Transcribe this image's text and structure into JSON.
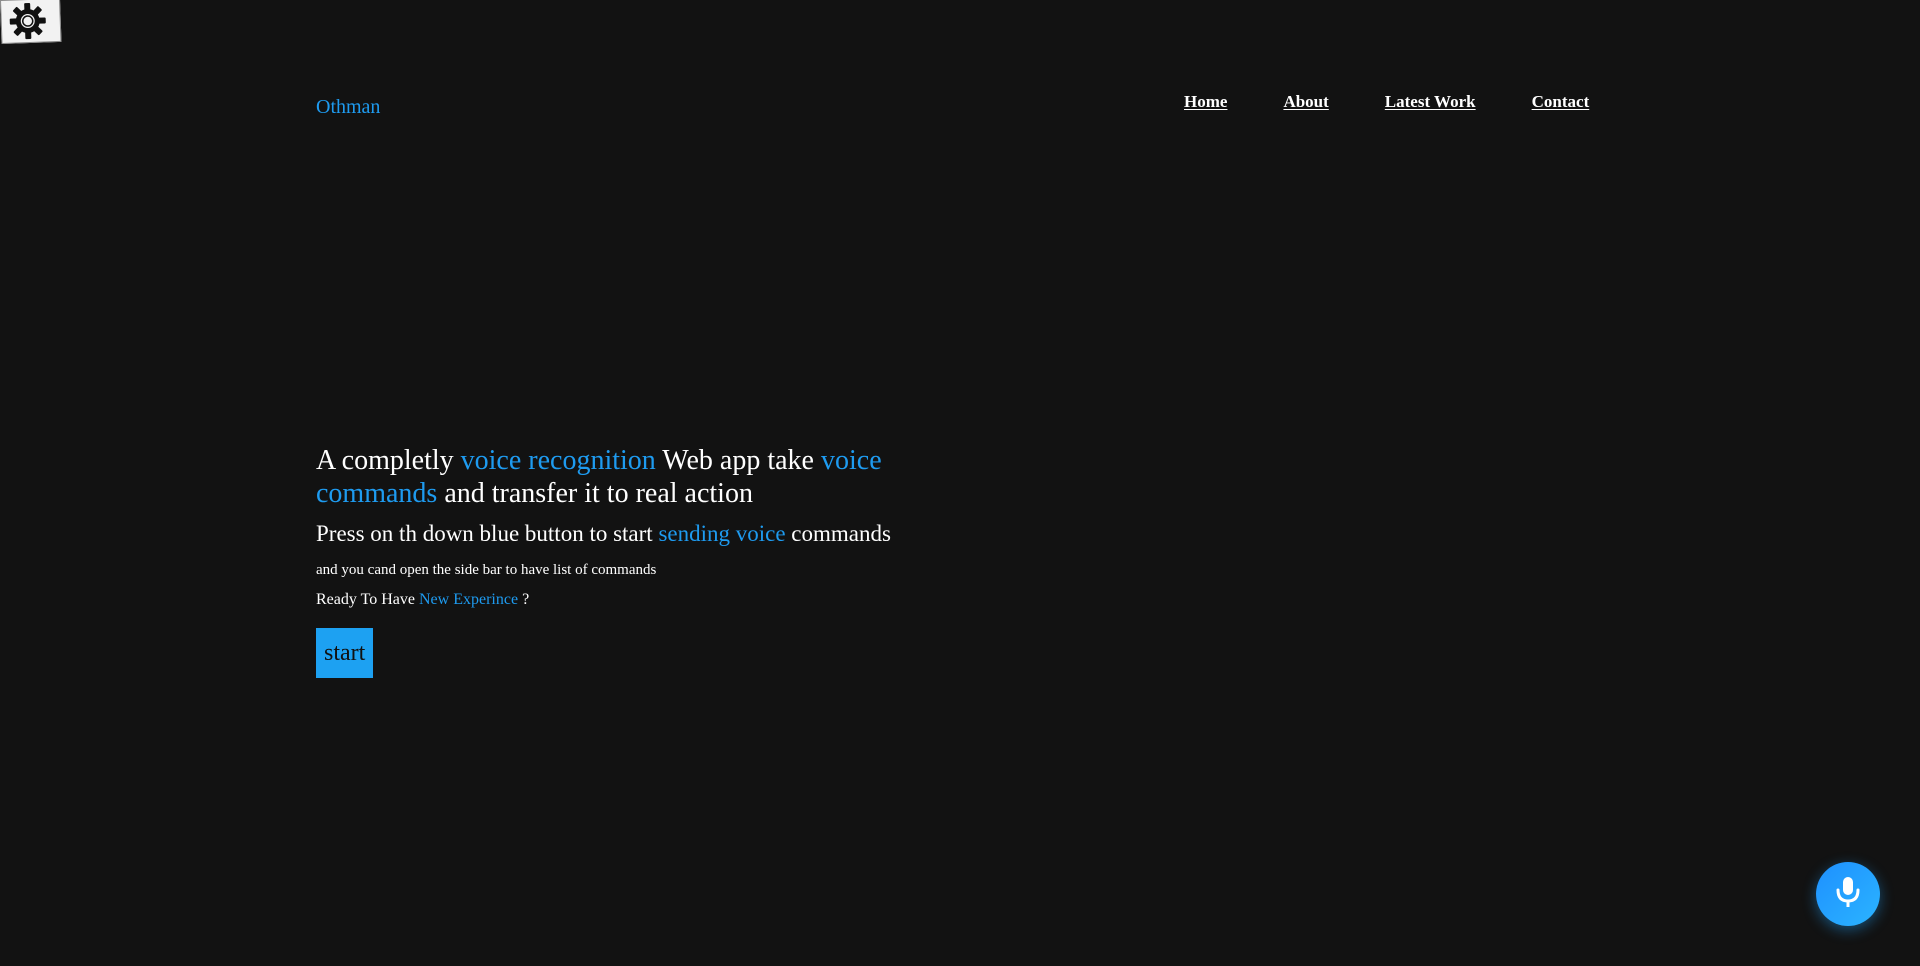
{
  "settings": {
    "icon": "gear-icon"
  },
  "header": {
    "brand": "Othman",
    "nav": [
      {
        "label": "Home"
      },
      {
        "label": "About"
      },
      {
        "label": "Latest Work"
      },
      {
        "label": "Contact"
      }
    ]
  },
  "hero": {
    "headline": {
      "p1": "A completly ",
      "p2": "voice recognition",
      "p3": " Web app take ",
      "p4": "voice commands",
      "p5": " and transfer it to real action"
    },
    "subhead": {
      "p1": "Press on th down blue button to start ",
      "p2": "sending voice",
      "p3": " commands"
    },
    "small": "and you cand open the side bar to have list of commands",
    "ready": {
      "p1": "Ready To Have ",
      "p2": "New Experince",
      "p3": " ?"
    },
    "start_label": "start"
  },
  "mic": {
    "icon": "microphone-icon"
  },
  "colors": {
    "background": "#121212",
    "accent": "#1e9bf0",
    "button": "#1da1f2"
  }
}
